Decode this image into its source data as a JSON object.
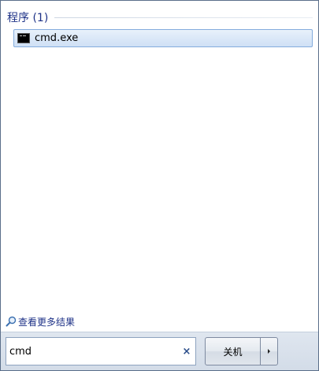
{
  "results": {
    "group_title": "程序 (1)",
    "items": [
      {
        "label": "cmd.exe",
        "icon": "cmd-icon"
      }
    ],
    "more_results": "查看更多结果"
  },
  "search": {
    "value": "cmd",
    "clear_glyph": "×"
  },
  "power": {
    "shutdown_label": "关机",
    "options_icon": "chevron-right-icon"
  },
  "colors": {
    "group_title": "#1e3287",
    "selection_border": "#84acdd",
    "selection_fill": "#dbe8f8",
    "bottom_bar": "#d3dce8"
  }
}
